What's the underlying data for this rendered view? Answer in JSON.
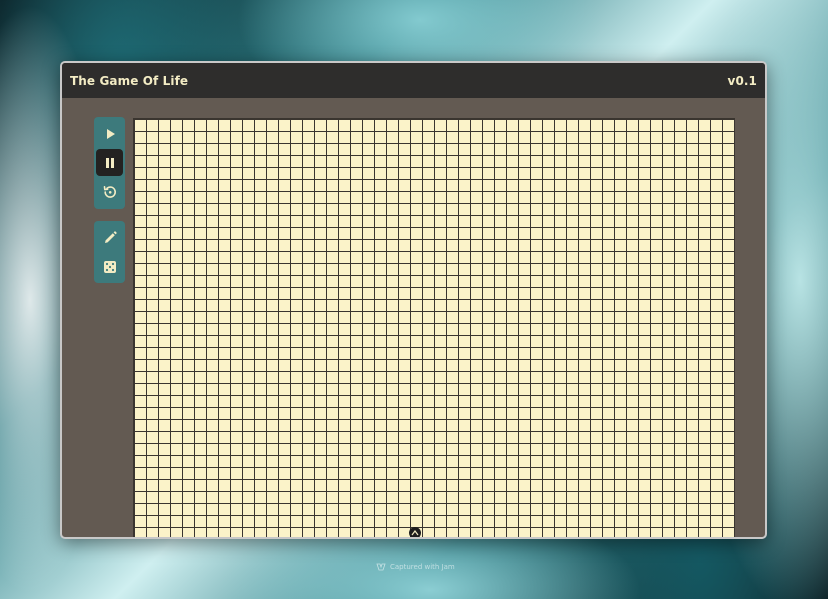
{
  "window": {
    "title": "The Game Of Life",
    "version": "v0.1"
  },
  "toolbar": {
    "playback": [
      {
        "name": "play",
        "icon": "play-icon",
        "active": false
      },
      {
        "name": "pause",
        "icon": "pause-icon",
        "active": true
      },
      {
        "name": "reset",
        "icon": "reset-icon",
        "active": false
      }
    ],
    "edit": [
      {
        "name": "draw",
        "icon": "pencil-icon",
        "active": false
      },
      {
        "name": "randomize",
        "icon": "dice-icon",
        "active": false
      }
    ]
  },
  "grid": {
    "cell_color": "#fbf3c9",
    "line_color": "#3a352f"
  },
  "colors": {
    "titlebar": "#2e2d2c",
    "title_text": "#f3ecc4",
    "panel_bg": "#635a52",
    "toolbar_bg": "#3d7a7c",
    "active_button": "#232221"
  },
  "watermark": {
    "text": "Captured with Jam"
  }
}
